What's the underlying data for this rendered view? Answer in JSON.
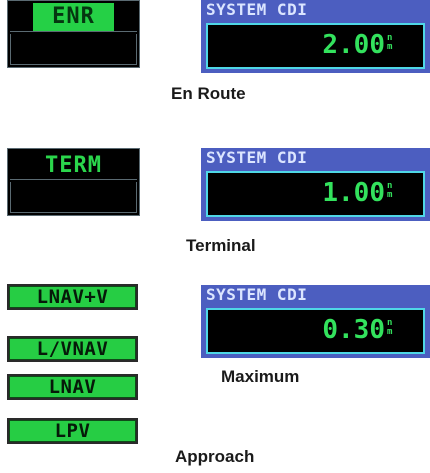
{
  "enroute": {
    "mode": "ENR",
    "cdi_title": "SYSTEM CDI",
    "cdi_value": "2.00",
    "cdi_unit_top": "n",
    "cdi_unit_bottom": "m",
    "caption": "En Route"
  },
  "terminal": {
    "mode": "TERM",
    "cdi_title": "SYSTEM CDI",
    "cdi_value": "1.00",
    "cdi_unit_top": "n",
    "cdi_unit_bottom": "m",
    "caption": "Terminal"
  },
  "maximum": {
    "cdi_title": "SYSTEM CDI",
    "cdi_value": "0.30",
    "cdi_unit_top": "n",
    "cdi_unit_bottom": "m",
    "caption": "Maximum"
  },
  "approach": {
    "modes": [
      "LNAV+V",
      "L/VNAV",
      "LNAV",
      "LPV"
    ],
    "caption": "Approach"
  },
  "colors": {
    "annunciator_green": "#26cd44",
    "cdi_panel_blue": "#4c5ec0",
    "cdi_field_border": "#4fd7e6",
    "cdi_value_green": "#33e25d"
  }
}
